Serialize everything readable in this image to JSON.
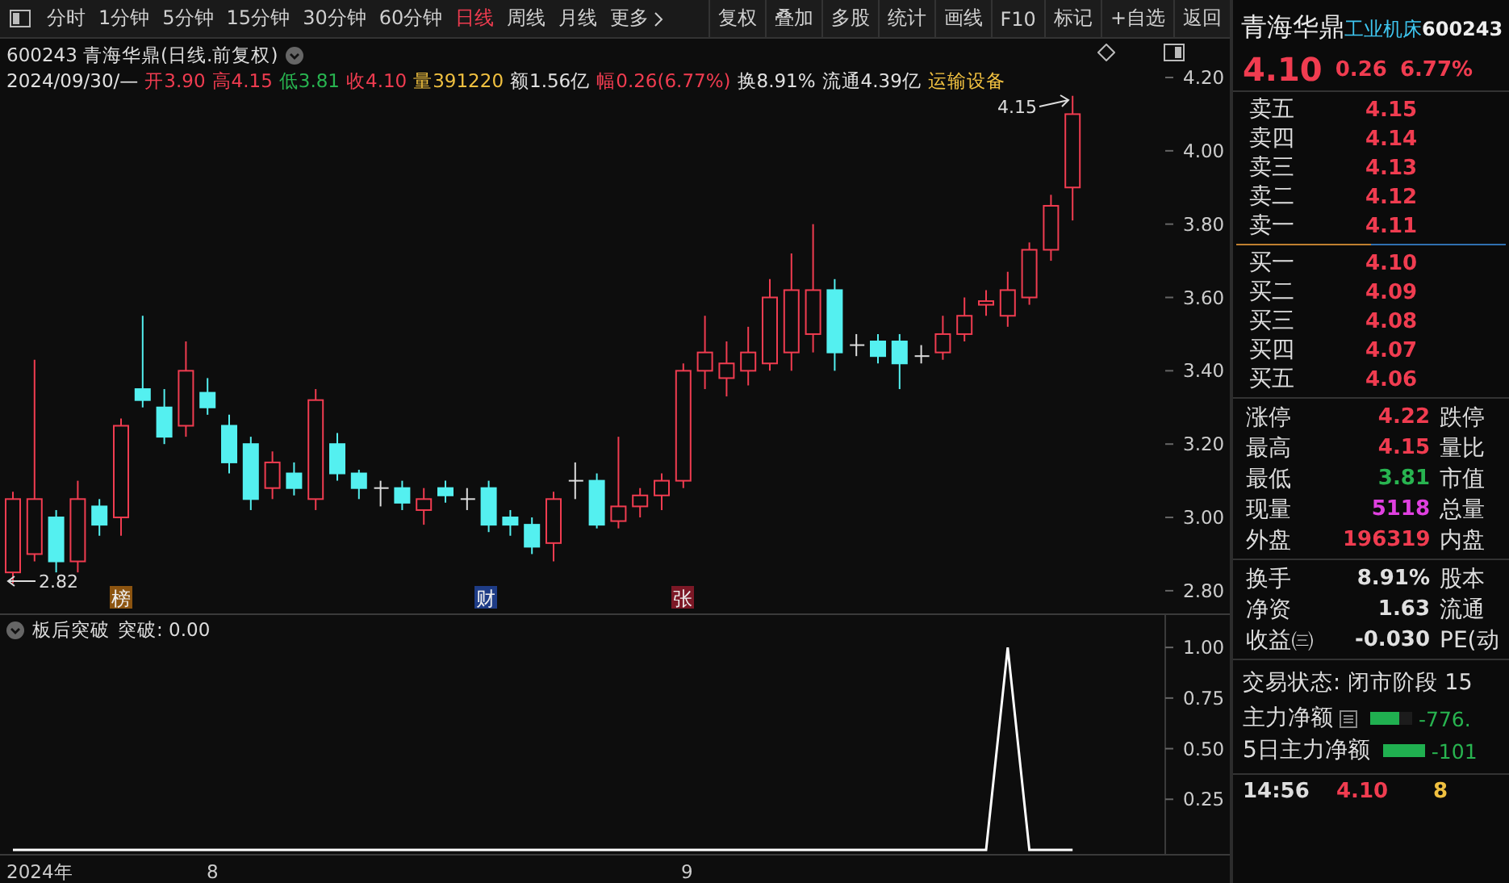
{
  "toolbar": {
    "periods": [
      {
        "label": "分时",
        "selected": false
      },
      {
        "label": "1分钟",
        "selected": false
      },
      {
        "label": "5分钟",
        "selected": false
      },
      {
        "label": "15分钟",
        "selected": false
      },
      {
        "label": "30分钟",
        "selected": false
      },
      {
        "label": "60分钟",
        "selected": false
      },
      {
        "label": "日线",
        "selected": true
      },
      {
        "label": "周线",
        "selected": false
      },
      {
        "label": "月线",
        "selected": false
      }
    ],
    "more": "更多",
    "buttons": [
      "复权",
      "叠加",
      "多股",
      "统计",
      "画线",
      "F10",
      "标记",
      "+自选",
      "返回"
    ]
  },
  "chart_header": {
    "title": "600243 青海华鼎(日线.前复权)",
    "quote": [
      {
        "text": "2024/09/30/—",
        "color": "#e0e0e0"
      },
      {
        "text": "开3.90",
        "color": "#f03c50"
      },
      {
        "text": "高4.15",
        "color": "#f03c50"
      },
      {
        "text": "低3.81",
        "color": "#28b450"
      },
      {
        "text": "收4.10",
        "color": "#f03c50"
      },
      {
        "text": "量391220",
        "color": "#f0c040"
      },
      {
        "text": "额1.56亿",
        "color": "#e0e0e0"
      },
      {
        "text": "幅0.26(6.77%)",
        "color": "#f03c50"
      },
      {
        "text": "换8.91%",
        "color": "#e0e0e0"
      },
      {
        "text": "流通4.39亿",
        "color": "#e0e0e0"
      },
      {
        "text": "运输设备",
        "color": "#f0c040"
      }
    ]
  },
  "price_chart": {
    "axis_labels": [
      "4.20",
      "4.00",
      "3.80",
      "3.60",
      "3.40",
      "3.20",
      "3.00",
      "2.80"
    ],
    "high_marker": "4.15",
    "low_marker": "2.82",
    "badges": [
      {
        "text": "榜",
        "color": "#8c5410"
      },
      {
        "text": "财",
        "color": "#1e3c86"
      },
      {
        "text": "张",
        "color": "#7c1826"
      }
    ]
  },
  "indicator": {
    "title": "板后突破",
    "reading": ": 0.00",
    "chart_data": {
      "type": "line",
      "ylim": [
        -0.02,
        1.16
      ],
      "yticks": [
        {
          "value": 1,
          "label": "1.00"
        },
        {
          "value": 0.75,
          "label": "0.75"
        },
        {
          "value": 0.5,
          "label": "0.50"
        },
        {
          "value": 0.25,
          "label": "0.25"
        }
      ],
      "series": [
        {
          "name": "突破",
          "color": "#ffffff",
          "values": [
            0,
            0,
            0,
            0,
            0,
            0,
            0,
            0,
            0,
            0,
            0,
            0,
            0,
            0,
            0,
            0,
            0,
            0,
            0,
            0,
            0,
            0,
            0,
            0,
            0,
            0,
            0,
            0,
            0,
            0,
            0,
            0,
            0,
            0,
            0,
            0,
            0,
            0,
            0,
            0,
            0,
            0,
            0,
            0,
            0,
            0,
            1,
            0,
            0,
            0
          ]
        }
      ]
    },
    "time_axis": [
      "2024年",
      "8",
      "9"
    ]
  },
  "quote_panel": {
    "name": "青海华鼎",
    "industry": "工业机床",
    "code": "600243",
    "price": "4.10",
    "change": "0.26",
    "change_pct": "6.77%",
    "asks": [
      {
        "label": "卖五",
        "price": "4.15"
      },
      {
        "label": "卖四",
        "price": "4.14"
      },
      {
        "label": "卖三",
        "price": "4.13"
      },
      {
        "label": "卖二",
        "price": "4.12"
      },
      {
        "label": "卖一",
        "price": "4.11"
      }
    ],
    "bids": [
      {
        "label": "买一",
        "price": "4.10"
      },
      {
        "label": "买二",
        "price": "4.09"
      },
      {
        "label": "买三",
        "price": "4.08"
      },
      {
        "label": "买四",
        "price": "4.07"
      },
      {
        "label": "买五",
        "price": "4.06"
      }
    ],
    "stats": [
      {
        "label": "涨停",
        "value": "4.22",
        "color": "#f03c50",
        "label_2": "跌停"
      },
      {
        "label": "最高",
        "value": "4.15",
        "color": "#f03c50",
        "label_2": "量比"
      },
      {
        "label": "最低",
        "value": "3.81",
        "color": "#28b450",
        "label_2": "市值"
      },
      {
        "label": "现量",
        "value": "5118",
        "color": "#e040e0",
        "label_2": "总量"
      },
      {
        "label": "外盘",
        "value": "196319",
        "color": "#f03c50",
        "label_2": "内盘"
      }
    ],
    "stats_2": [
      {
        "label": "换手",
        "value": "8.91%",
        "color": "#e0e0e0",
        "label_2": "股本"
      },
      {
        "label": "净资",
        "value": "1.63",
        "color": "#e0e0e0",
        "label_2": "流通"
      },
      {
        "label": "收益㈢",
        "value": "-0.030",
        "color": "#e0e0e0",
        "label_2": "PE(动"
      }
    ],
    "trade_state": "交易状态: 闭市阶段 15",
    "flows": [
      {
        "label": "主力净额",
        "menu_icon": true,
        "level": 0.7,
        "value": "-776."
      },
      {
        "label": "5日主力净额",
        "menu_icon": false,
        "level": 1,
        "value": "-101"
      }
    ],
    "ticks": [
      {
        "time": "14:56",
        "price": "4.10",
        "volume": "8"
      }
    ]
  }
}
